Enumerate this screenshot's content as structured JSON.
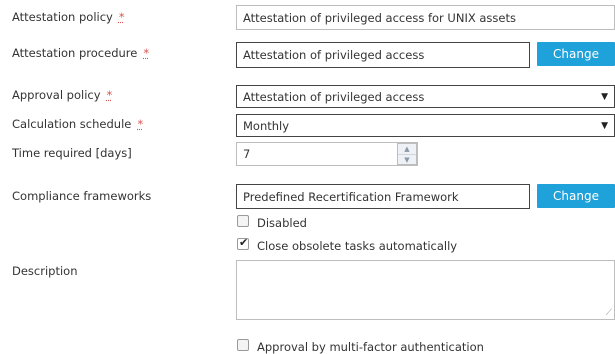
{
  "fields": {
    "attestation_policy": {
      "label": "Attestation policy",
      "required_mark": "*",
      "value": "Attestation of privileged access for UNIX assets"
    },
    "attestation_procedure": {
      "label": "Attestation procedure",
      "required_mark": "*",
      "value": "Attestation of privileged access",
      "button": "Change"
    },
    "approval_policy": {
      "label": "Approval policy",
      "required_mark": "*",
      "value": "Attestation of privileged access",
      "arrow": "▼"
    },
    "calculation_schedule": {
      "label": "Calculation schedule",
      "required_mark": "*",
      "value": "Monthly",
      "arrow": "▼"
    },
    "time_required": {
      "label": "Time required [days]",
      "value": "7",
      "up": "▲",
      "down": "▼"
    },
    "compliance_frameworks": {
      "label": "Compliance frameworks",
      "value": "Predefined Recertification Framework",
      "button": "Change"
    },
    "description": {
      "label": "Description",
      "value": ""
    }
  },
  "checkboxes": {
    "disabled": {
      "label": "Disabled",
      "checked": false
    },
    "close_obsolete": {
      "label": "Close obsolete tasks automatically",
      "checked": true
    },
    "mfa": {
      "label": "Approval by multi-factor authentication",
      "checked": false
    }
  },
  "colors": {
    "accent": "#1fa1d9",
    "required": "#d9534f"
  }
}
